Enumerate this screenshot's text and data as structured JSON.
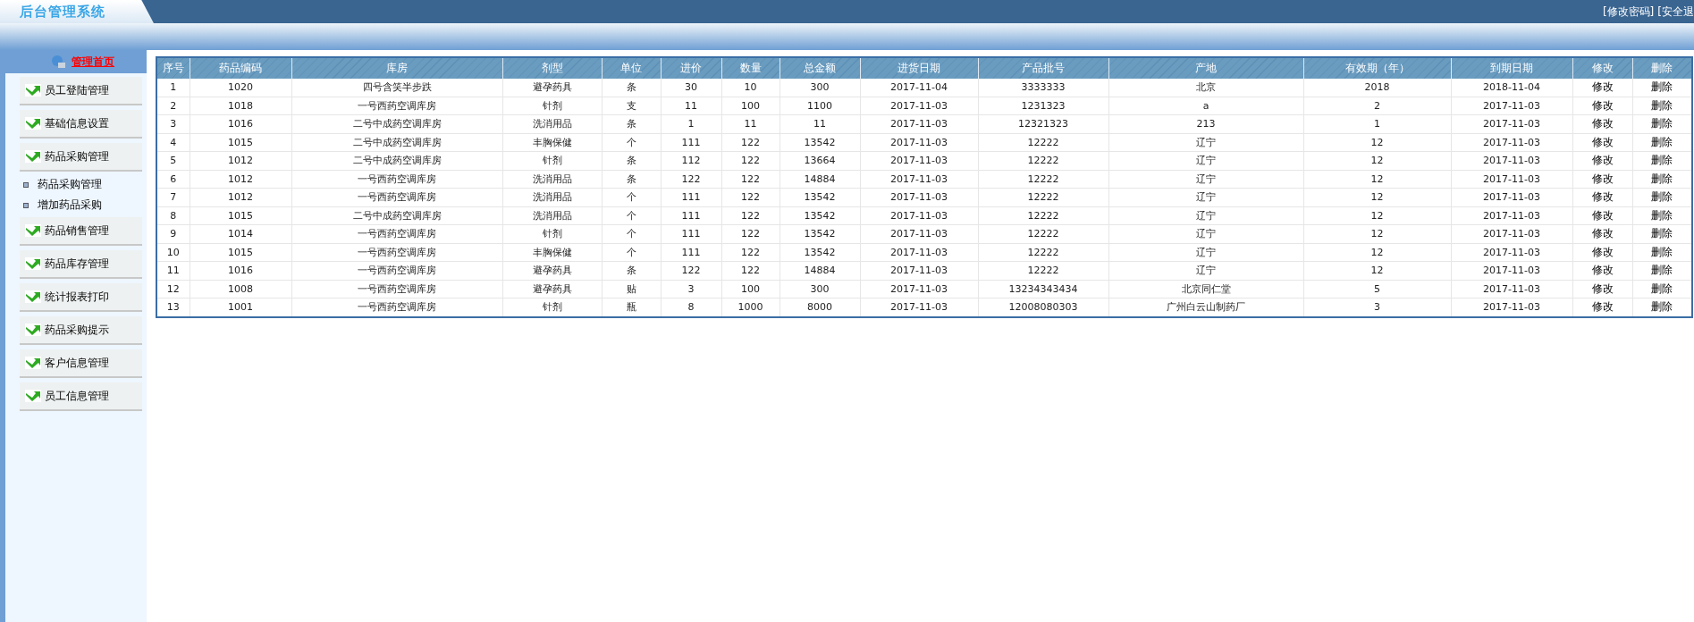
{
  "header": {
    "logo": "后台管理系统",
    "links": [
      "[修改密码]",
      "[安全退"
    ]
  },
  "sidebar": {
    "home": "管理首页",
    "items": [
      {
        "label": "员工登陆管理"
      },
      {
        "label": "基础信息设置"
      },
      {
        "label": "药品采购管理",
        "children": [
          {
            "label": "药品采购管理"
          },
          {
            "label": "增加药品采购"
          }
        ]
      },
      {
        "label": "药品销售管理"
      },
      {
        "label": "药品库存管理"
      },
      {
        "label": "统计报表打印"
      },
      {
        "label": "药品采购提示"
      },
      {
        "label": "客户信息管理"
      },
      {
        "label": "员工信息管理"
      }
    ]
  },
  "table": {
    "columns": [
      {
        "label": "序号",
        "kind": "text"
      },
      {
        "label": "药品编码",
        "kind": "text"
      },
      {
        "label": "库房",
        "kind": "text"
      },
      {
        "label": "剂型",
        "kind": "text"
      },
      {
        "label": "单位",
        "kind": "text"
      },
      {
        "label": "进价",
        "kind": "text"
      },
      {
        "label": "数量",
        "kind": "text"
      },
      {
        "label": "总金额",
        "kind": "text"
      },
      {
        "label": "进货日期",
        "kind": "text"
      },
      {
        "label": "产品批号",
        "kind": "text"
      },
      {
        "label": "产地",
        "kind": "text"
      },
      {
        "label": "有效期（年）",
        "kind": "text"
      },
      {
        "label": "到期日期",
        "kind": "text"
      },
      {
        "label": "修改",
        "kind": "link"
      },
      {
        "label": "删除",
        "kind": "link"
      }
    ],
    "rows": [
      [
        "1",
        "1020",
        "四号含笑半步跌",
        "避孕药具",
        "条",
        "30",
        "10",
        "300",
        "2017-11-04",
        "3333333",
        "北京",
        "2018",
        "2018-11-04",
        "修改",
        "删除"
      ],
      [
        "2",
        "1018",
        "一号西药空调库房",
        "针剂",
        "支",
        "11",
        "100",
        "1100",
        "2017-11-03",
        "1231323",
        "a",
        "2",
        "2017-11-03",
        "修改",
        "删除"
      ],
      [
        "3",
        "1016",
        "二号中成药空调库房",
        "洗消用品",
        "条",
        "1",
        "11",
        "11",
        "2017-11-03",
        "12321323",
        "213",
        "1",
        "2017-11-03",
        "修改",
        "删除"
      ],
      [
        "4",
        "1015",
        "二号中成药空调库房",
        "丰胸保健",
        "个",
        "111",
        "122",
        "13542",
        "2017-11-03",
        "12222",
        "辽宁",
        "12",
        "2017-11-03",
        "修改",
        "删除"
      ],
      [
        "5",
        "1012",
        "二号中成药空调库房",
        "针剂",
        "条",
        "112",
        "122",
        "13664",
        "2017-11-03",
        "12222",
        "辽宁",
        "12",
        "2017-11-03",
        "修改",
        "删除"
      ],
      [
        "6",
        "1012",
        "一号西药空调库房",
        "洗消用品",
        "条",
        "122",
        "122",
        "14884",
        "2017-11-03",
        "12222",
        "辽宁",
        "12",
        "2017-11-03",
        "修改",
        "删除"
      ],
      [
        "7",
        "1012",
        "一号西药空调库房",
        "洗消用品",
        "个",
        "111",
        "122",
        "13542",
        "2017-11-03",
        "12222",
        "辽宁",
        "12",
        "2017-11-03",
        "修改",
        "删除"
      ],
      [
        "8",
        "1015",
        "二号中成药空调库房",
        "洗消用品",
        "个",
        "111",
        "122",
        "13542",
        "2017-11-03",
        "12222",
        "辽宁",
        "12",
        "2017-11-03",
        "修改",
        "删除"
      ],
      [
        "9",
        "1014",
        "一号西药空调库房",
        "针剂",
        "个",
        "111",
        "122",
        "13542",
        "2017-11-03",
        "12222",
        "辽宁",
        "12",
        "2017-11-03",
        "修改",
        "删除"
      ],
      [
        "10",
        "1015",
        "一号西药空调库房",
        "丰胸保健",
        "个",
        "111",
        "122",
        "13542",
        "2017-11-03",
        "12222",
        "辽宁",
        "12",
        "2017-11-03",
        "修改",
        "删除"
      ],
      [
        "11",
        "1016",
        "一号西药空调库房",
        "避孕药具",
        "条",
        "122",
        "122",
        "14884",
        "2017-11-03",
        "12222",
        "辽宁",
        "12",
        "2017-11-03",
        "修改",
        "删除"
      ],
      [
        "12",
        "1008",
        "一号西药空调库房",
        "避孕药具",
        "贴",
        "3",
        "100",
        "300",
        "2017-11-03",
        "13234343434",
        "北京同仁堂",
        "5",
        "2017-11-03",
        "修改",
        "删除"
      ],
      [
        "13",
        "1001",
        "一号西药空调库房",
        "针剂",
        "瓶",
        "8",
        "1000",
        "8000",
        "2017-11-03",
        "12008080303",
        "广州白云山制药厂",
        "3",
        "2017-11-03",
        "修改",
        "删除"
      ]
    ]
  }
}
